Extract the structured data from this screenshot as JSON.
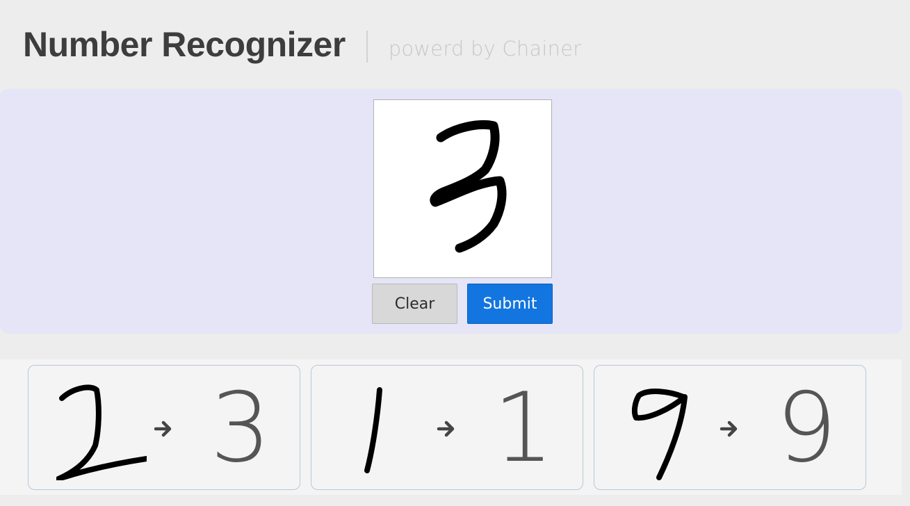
{
  "header": {
    "title": "Number Recognizer",
    "subtitle": "powerd by Chainer"
  },
  "draw_panel": {
    "canvas_digit_drawn": "3",
    "clear_label": "Clear",
    "submit_label": "Submit"
  },
  "history": [
    {
      "drawn_icon": "handwritten-2-sketch",
      "arrow_icon": "arrow-right-icon",
      "prediction": "3"
    },
    {
      "drawn_icon": "handwritten-1-sketch",
      "arrow_icon": "arrow-right-icon",
      "prediction": "1"
    },
    {
      "drawn_icon": "handwritten-9-sketch",
      "arrow_icon": "arrow-right-icon",
      "prediction": "9"
    }
  ],
  "colors": {
    "background": "#ededed",
    "panel": "#e5e5f7",
    "submit": "#1375df",
    "clear": "#d8d8d8",
    "card_border": "#b8c8d8",
    "title": "#3d3d3d"
  }
}
